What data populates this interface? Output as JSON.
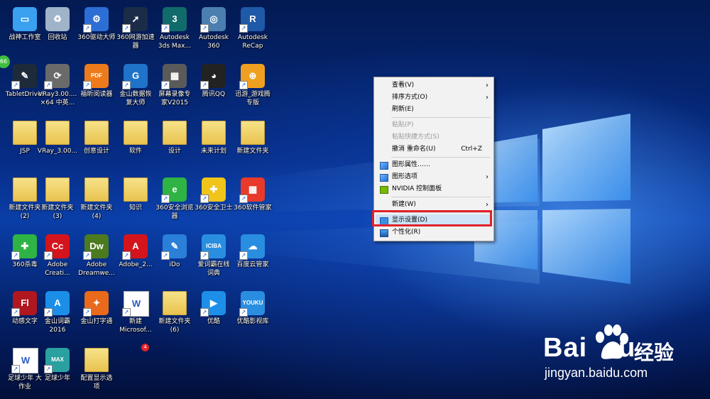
{
  "desktop_icons": [
    {
      "label": "战神工作室",
      "icon": "computer-icon"
    },
    {
      "label": "TabletDriver",
      "icon": "tablet-driver-icon"
    },
    {
      "label": "JSP",
      "icon": "folder-icon"
    },
    {
      "label": "新建文件夹\n(2)",
      "icon": "folder-icon"
    },
    {
      "label": "360杀毒",
      "icon": "360-antivirus-icon"
    },
    {
      "label": "动感文字",
      "icon": "flash-file-icon"
    },
    {
      "label": "足球少年 大\n作业",
      "icon": "word-doc-icon"
    },
    {
      "label": "回收站",
      "icon": "recycle-bin-icon"
    },
    {
      "label": "VRay3.00....\n×64 中英...",
      "icon": "vray-icon"
    },
    {
      "label": "VRay_3.00...",
      "icon": "folder-icon"
    },
    {
      "label": "新建文件夹\n(3)",
      "icon": "folder-icon"
    },
    {
      "label": "Adobe\nCreati...",
      "icon": "adobe-cc-icon"
    },
    {
      "label": "金山词霸\n2016",
      "icon": "kingsoft-dict-icon"
    },
    {
      "label": "足球少年",
      "icon": "3dsmax-file-icon"
    },
    {
      "label": "360驱动大师",
      "icon": "360-driver-icon"
    },
    {
      "label": "福昕阅读器",
      "icon": "foxit-pdf-icon"
    },
    {
      "label": "创意设计",
      "icon": "folder-icon"
    },
    {
      "label": "新建文件夹\n(4)",
      "icon": "folder-icon"
    },
    {
      "label": "Adobe\nDreamwe...",
      "icon": "dreamweaver-icon"
    },
    {
      "label": "金山打字通",
      "icon": "kingsoft-typing-icon"
    },
    {
      "label": "配置显示选\n项",
      "icon": "folder-icon"
    },
    {
      "label": "360网游加速\n器",
      "icon": "360-game-accelerator-icon"
    },
    {
      "label": "金山数据恢\n复大师",
      "icon": "kingsoft-recovery-icon"
    },
    {
      "label": "软件",
      "icon": "folder-icon"
    },
    {
      "label": "知识",
      "icon": "folder-icon"
    },
    {
      "label": "Adobe_2...",
      "icon": "adobe-icon"
    },
    {
      "label": "新建\nMicrosof...",
      "icon": "word-doc-icon"
    },
    {
      "label": "Autodesk\n3ds Max...",
      "icon": "3dsmax-icon"
    },
    {
      "label": "屏幕录像专\n家V2015",
      "icon": "screen-recorder-icon"
    },
    {
      "label": "设计",
      "icon": "folder-icon"
    },
    {
      "label": "360安全浏览\n器",
      "icon": "360-browser-icon"
    },
    {
      "label": "iDo",
      "icon": "ido-icon"
    },
    {
      "label": "新建文件夹\n(6)",
      "icon": "folder-icon"
    },
    {
      "label": "Autodesk\n360",
      "icon": "autodesk-360-icon"
    },
    {
      "label": "腾讯QQ",
      "icon": "qq-icon"
    },
    {
      "label": "未来计划",
      "icon": "folder-icon"
    },
    {
      "label": "360安全卫士",
      "icon": "360-safe-icon"
    },
    {
      "label": "爱词霸在线\n词典",
      "icon": "iciba-icon"
    },
    {
      "label": "优酷",
      "icon": "youku-icon"
    },
    {
      "label": "Autodesk\nReCap",
      "icon": "autodesk-recap-icon"
    },
    {
      "label": "迅游_游戏腾\n专版",
      "icon": "xunyou-icon"
    },
    {
      "label": "新建文件夹",
      "icon": "folder-icon"
    },
    {
      "label": "360软件管家",
      "icon": "360-software-manager-icon"
    },
    {
      "label": "百度云管家",
      "icon": "baidu-cloud-icon"
    },
    {
      "label": "优酷影视库",
      "icon": "youku-library-icon"
    }
  ],
  "badges": {
    "recycle_bin_overlay": "66",
    "software_manager_badge": "4"
  },
  "context_menu": {
    "items": [
      {
        "label": "查看(V)",
        "state": "enabled",
        "submenu": true
      },
      {
        "label": "排序方式(O)",
        "state": "enabled",
        "submenu": true
      },
      {
        "label": "刷新(E)",
        "state": "enabled"
      },
      {
        "label": "粘贴(P)",
        "state": "disabled"
      },
      {
        "label": "粘贴快捷方式(S)",
        "state": "disabled"
      },
      {
        "label": "撤消 重命名(U)",
        "state": "enabled",
        "shortcut": "Ctrl+Z"
      },
      {
        "label": "图形属性……",
        "state": "enabled",
        "icon": "intel-graphics-icon"
      },
      {
        "label": "图形选项",
        "state": "enabled",
        "submenu": true,
        "icon": "intel-graphics-icon"
      },
      {
        "label": "NVIDIA 控制面板",
        "state": "enabled",
        "icon": "nvidia-icon"
      },
      {
        "label": "新建(W)",
        "state": "enabled",
        "submenu": true
      },
      {
        "label": "显示设置(D)",
        "state": "highlighted",
        "icon": "display-settings-icon"
      },
      {
        "label": "个性化(R)",
        "state": "enabled",
        "icon": "personalize-icon"
      }
    ],
    "highlight_color": "#cfe3f6",
    "callout_color": "#e0222a"
  },
  "watermark": {
    "brand": "Bai",
    "brand_suffix": "u",
    "chinese": "经验",
    "url": "jingyan.baidu.com"
  },
  "colors": {
    "wallpaper_blue": "#0a3ea8",
    "folder_yellow": "#e8c24d"
  }
}
